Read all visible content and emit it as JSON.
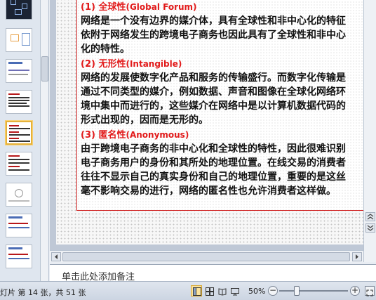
{
  "thumbnails": {
    "numbers": [
      "",
      "",
      "",
      "",
      "",
      "",
      "",
      "",
      "",
      ""
    ]
  },
  "slide": {
    "sections": [
      {
        "heading_cn": "(1) 全球性",
        "heading_en": "(Global Forum)",
        "lines": [
          "网络是一个没有边界的媒介体，具有全球性和非中心化的特征",
          "依附于网络发生的跨境电子商务也因此具有了全球性和非中心",
          "化的特性。"
        ]
      },
      {
        "heading_cn": "(2) 无形性",
        "heading_en": "(Intangible)",
        "lines": [
          "网络的发展使数字化产品和服务的传输盛行。而数字化传输是",
          "通过不同类型的媒介，例如数据、声音和图像在全球化网络环",
          "境中集中而进行的，这些媒介在网络中是以计算机数据代码的",
          "形式出现的，因而是无形的。"
        ]
      },
      {
        "heading_cn": "(3) 匿名性",
        "heading_en": "(Anonymous)",
        "lines": [
          "由于跨境电子商务的非中心化和全球性的特性，因此很难识别",
          "电子商务用户的身份和其所处的地理位置。在线交易的消费者",
          "往往不显示自己的真实身份和自己的地理位置，重要的是这丝",
          "毫不影响交易的进行，网络的匿名性也允许消费者这样做。"
        ]
      }
    ]
  },
  "notes": {
    "placeholder": "单击此处添加备注"
  },
  "status_bar": {
    "slide_info": "灯片 第 14 张，共 51 张",
    "zoom_level": "50%",
    "zoom_minus": "−",
    "zoom_plus": "+"
  },
  "colors": {
    "heading_red": "#e21a1a",
    "border_red": "#d02020",
    "selected_thumb": "#e6b23a"
  }
}
